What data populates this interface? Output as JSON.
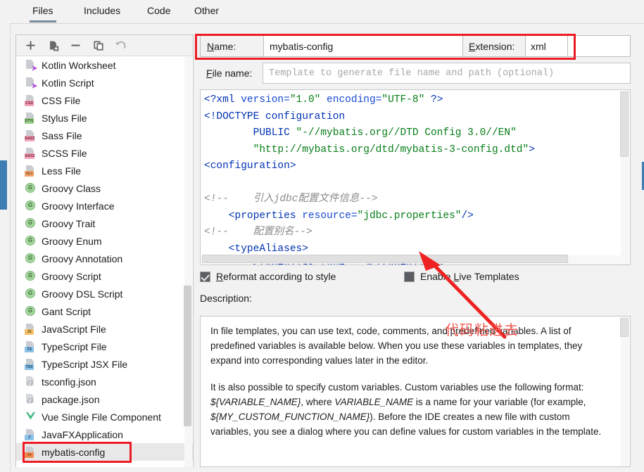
{
  "tabs": [
    {
      "label": "Files",
      "active": true
    },
    {
      "label": "Includes",
      "active": false
    },
    {
      "label": "Code",
      "active": false
    },
    {
      "label": "Other",
      "active": false
    }
  ],
  "toolbar": {
    "add": "+",
    "add_child": "add-template-icon",
    "remove": "−",
    "copy": "copy-icon",
    "reset": "↺"
  },
  "file_list": [
    {
      "label": "Kotlin Worksheet",
      "icon": "kotlin-file-icon",
      "selected": false
    },
    {
      "label": "Kotlin Script",
      "icon": "kotlin-file-icon",
      "selected": false
    },
    {
      "label": "CSS File",
      "icon": "css-file-icon",
      "selected": false
    },
    {
      "label": "Stylus File",
      "icon": "stylus-file-icon",
      "selected": false
    },
    {
      "label": "Sass File",
      "icon": "sass-file-icon",
      "selected": false
    },
    {
      "label": "SCSS File",
      "icon": "scss-file-icon",
      "selected": false
    },
    {
      "label": "Less File",
      "icon": "less-file-icon",
      "selected": false
    },
    {
      "label": "Groovy Class",
      "icon": "groovy-icon",
      "selected": false
    },
    {
      "label": "Groovy Interface",
      "icon": "groovy-icon",
      "selected": false
    },
    {
      "label": "Groovy Trait",
      "icon": "groovy-icon",
      "selected": false
    },
    {
      "label": "Groovy Enum",
      "icon": "groovy-icon",
      "selected": false
    },
    {
      "label": "Groovy Annotation",
      "icon": "groovy-icon",
      "selected": false
    },
    {
      "label": "Groovy Script",
      "icon": "groovy-icon",
      "selected": false
    },
    {
      "label": "Groovy DSL Script",
      "icon": "groovy-icon",
      "selected": false
    },
    {
      "label": "Gant Script",
      "icon": "groovy-icon",
      "selected": false
    },
    {
      "label": "JavaScript File",
      "icon": "javascript-file-icon",
      "selected": false
    },
    {
      "label": "TypeScript File",
      "icon": "typescript-file-icon",
      "selected": false
    },
    {
      "label": "TypeScript JSX File",
      "icon": "typescript-jsx-file-icon",
      "selected": false
    },
    {
      "label": "tsconfig.json",
      "icon": "json-file-icon",
      "selected": false
    },
    {
      "label": "package.json",
      "icon": "json-file-icon",
      "selected": false
    },
    {
      "label": "Vue Single File Component",
      "icon": "vue-file-icon",
      "selected": false
    },
    {
      "label": "JavaFXApplication",
      "icon": "java-file-icon",
      "selected": false
    },
    {
      "label": "mybatis-config",
      "icon": "xml-file-icon",
      "selected": true
    }
  ],
  "form": {
    "name_label": "Name:",
    "name_value": "mybatis-config",
    "extension_label": "Extension:",
    "extension_value": "xml",
    "filename_label": "File name:",
    "filename_placeholder": "Template to generate file name and path (optional)"
  },
  "editor": {
    "lines": [
      {
        "segments": [
          {
            "t": "<?xml",
            "c": "c-pi"
          },
          {
            "t": " version=",
            "c": "c-attr"
          },
          {
            "t": "\"1.0\"",
            "c": "c-str"
          },
          {
            "t": " encoding=",
            "c": "c-attr"
          },
          {
            "t": "\"UTF-8\"",
            "c": "c-str"
          },
          {
            "t": " ?>",
            "c": "c-pi"
          }
        ]
      },
      {
        "segments": [
          {
            "t": "<!DOCTYPE configuration",
            "c": "c-tag"
          }
        ]
      },
      {
        "segments": [
          {
            "t": "        PUBLIC ",
            "c": "c-tag"
          },
          {
            "t": "\"-//mybatis.org//DTD Config 3.0//EN\"",
            "c": "c-str"
          }
        ]
      },
      {
        "segments": [
          {
            "t": "        ",
            "c": "c-txt"
          },
          {
            "t": "\"http://mybatis.org/dtd/mybatis-3-config.dtd\"",
            "c": "c-str"
          },
          {
            "t": ">",
            "c": "c-tag"
          }
        ]
      },
      {
        "segments": [
          {
            "t": "<configuration>",
            "c": "c-tag"
          }
        ]
      },
      {
        "segments": [
          {
            "t": "",
            "c": "c-txt"
          }
        ]
      },
      {
        "segments": [
          {
            "t": "<!--    引入jdbc配置文件信息-->",
            "c": "c-cmt"
          }
        ]
      },
      {
        "segments": [
          {
            "t": "    <properties",
            "c": "c-tag"
          },
          {
            "t": " resource=",
            "c": "c-attr"
          },
          {
            "t": "\"jdbc.properties\"",
            "c": "c-str"
          },
          {
            "t": "/>",
            "c": "c-tag"
          }
        ]
      },
      {
        "segments": [
          {
            "t": "<!--    配置别名-->",
            "c": "c-cmt"
          }
        ]
      },
      {
        "segments": [
          {
            "t": "    <typeAliases>",
            "c": "c-tag"
          }
        ]
      },
      {
        "segments": [
          {
            "t": "        <typeAlias",
            "c": "c-tag"
          },
          {
            "t": " type=",
            "c": "c-attr"
          },
          {
            "t": "\"\"",
            "c": "c-str"
          },
          {
            "t": "></typeAlias>",
            "c": "c-tag"
          }
        ]
      }
    ]
  },
  "options": {
    "reformat_label": "Reformat according to style",
    "reformat_checked": true,
    "live_templates_label": "Enable Live Templates",
    "live_templates_checked": false
  },
  "description": {
    "label": "Description:",
    "paragraph1_a": "In file templates, you can use text, code, comments, and predefined variables. A list of predefined variables is available below. When you use these variables in templates, they expand into corresponding values later in the editor.",
    "paragraph2_a": "It is also possible to specify custom variables. Custom variables use the following format: ",
    "paragraph2_var1": "${VARIABLE_NAME}",
    "paragraph2_b": ", where ",
    "paragraph2_var2": "VARIABLE_NAME",
    "paragraph2_c": " is a name for your variable (for example, ",
    "paragraph2_var3": "${MY_CUSTOM_FUNCTION_NAME}",
    "paragraph2_d": "). Before the IDE creates a new file with custom variables, you see a dialog where you can define values for custom variables in the template."
  },
  "annotations": {
    "chinese_note": "代码粘进去",
    "highlight_color": "#ed1c24",
    "arrow_color": "#ee2222",
    "note_color": "#f0574f"
  }
}
